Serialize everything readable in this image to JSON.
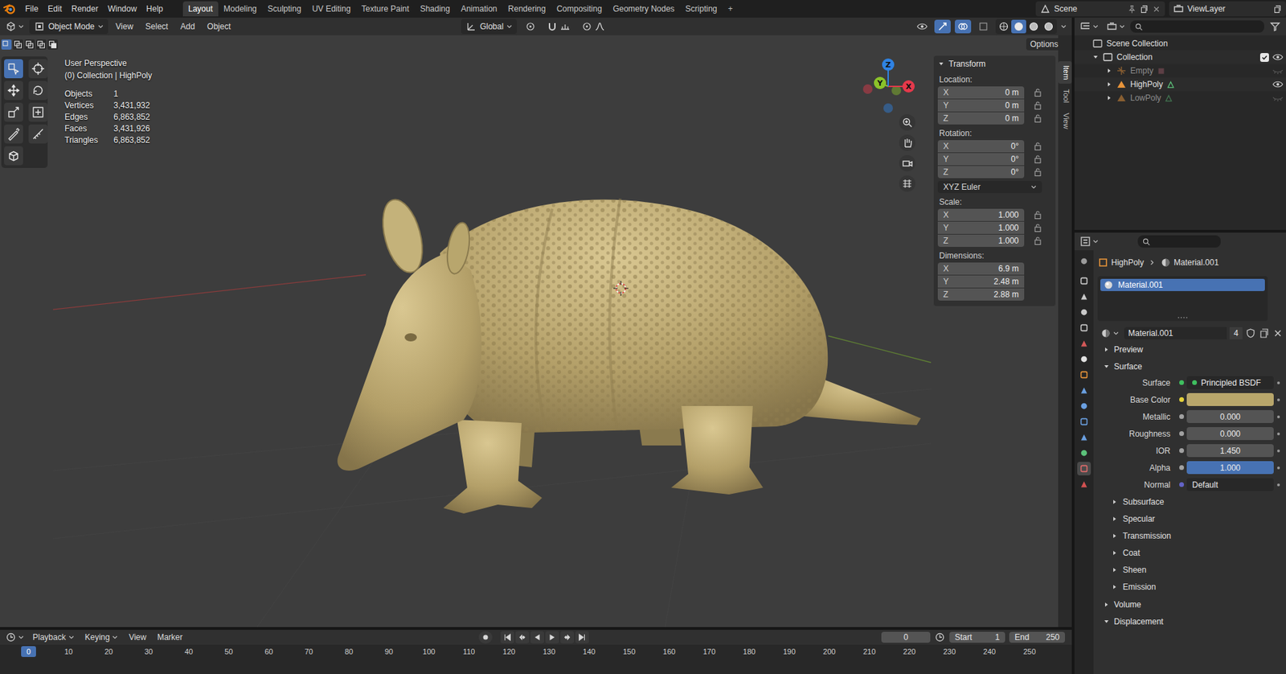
{
  "top_bar": {
    "menus": [
      "File",
      "Edit",
      "Render",
      "Window",
      "Help"
    ],
    "workspaces": [
      {
        "label": "Layout",
        "selected": true
      },
      {
        "label": "Modeling",
        "selected": false
      },
      {
        "label": "Sculpting",
        "selected": false
      },
      {
        "label": "UV Editing",
        "selected": false
      },
      {
        "label": "Texture Paint",
        "selected": false
      },
      {
        "label": "Shading",
        "selected": false
      },
      {
        "label": "Animation",
        "selected": false
      },
      {
        "label": "Rendering",
        "selected": false
      },
      {
        "label": "Compositing",
        "selected": false
      },
      {
        "label": "Geometry Nodes",
        "selected": false
      },
      {
        "label": "Scripting",
        "selected": false
      }
    ],
    "add_workspace": "+",
    "scene": "Scene",
    "view_layer": "ViewLayer"
  },
  "viewport": {
    "header": {
      "mode": "Object Mode",
      "menus": [
        "View",
        "Select",
        "Add",
        "Object"
      ],
      "orientation": "Global",
      "options": "Options",
      "select_modes": [
        {
          "selected": true
        },
        {
          "selected": false
        },
        {
          "selected": false
        },
        {
          "selected": false
        },
        {
          "selected": false
        }
      ],
      "shading": [
        {
          "selected": false
        },
        {
          "selected": true
        },
        {
          "selected": false
        },
        {
          "selected": false
        }
      ]
    },
    "tools": [
      {
        "selected": true
      },
      {
        "selected": false
      },
      {
        "selected": false
      },
      {
        "selected": false
      },
      {
        "selected": false
      },
      {
        "selected": false
      },
      {
        "selected": false
      },
      {
        "selected": false
      },
      {
        "selected": false
      }
    ],
    "overlay": {
      "view": "User Perspective",
      "context": "(0) Collection | HighPoly",
      "stats": [
        {
          "label": "Objects",
          "value": "1"
        },
        {
          "label": "Vertices",
          "value": "3,431,932"
        },
        {
          "label": "Edges",
          "value": "6,863,852"
        },
        {
          "label": "Faces",
          "value": "3,431,926"
        },
        {
          "label": "Triangles",
          "value": "6,863,852"
        }
      ]
    },
    "gizmo": {
      "axes": [
        {
          "label": "X",
          "color": "#e5394b"
        },
        {
          "label": "Y",
          "color": "#8bc32a"
        },
        {
          "label": "Z",
          "color": "#2f83e3"
        }
      ]
    },
    "sidebar": {
      "tabs": [
        {
          "label": "Item",
          "selected": true
        },
        {
          "label": "Tool",
          "selected": false
        },
        {
          "label": "View",
          "selected": false
        }
      ],
      "panel": "Transform",
      "groups": [
        {
          "label": "Location:",
          "locks": true,
          "fields": [
            {
              "axis": "X",
              "value": "0 m"
            },
            {
              "axis": "Y",
              "value": "0 m"
            },
            {
              "axis": "Z",
              "value": "0 m"
            }
          ]
        },
        {
          "label": "Rotation:",
          "locks": true,
          "mode": "XYZ Euler",
          "fields": [
            {
              "axis": "X",
              "value": "0°"
            },
            {
              "axis": "Y",
              "value": "0°"
            },
            {
              "axis": "Z",
              "value": "0°"
            }
          ]
        },
        {
          "label": "Scale:",
          "locks": true,
          "fields": [
            {
              "axis": "X",
              "value": "1.000"
            },
            {
              "axis": "Y",
              "value": "1.000"
            },
            {
              "axis": "Z",
              "value": "1.000"
            }
          ]
        },
        {
          "label": "Dimensions:",
          "locks": false,
          "fields": [
            {
              "axis": "X",
              "value": "6.9 m"
            },
            {
              "axis": "Y",
              "value": "2.48 m"
            },
            {
              "axis": "Z",
              "value": "2.88 m"
            }
          ]
        }
      ]
    }
  },
  "outliner": {
    "root": "Scene Collection",
    "collection": {
      "name": "Collection",
      "checked": true,
      "expanded": true,
      "children": [
        {
          "name": "Empty",
          "kind": "empty",
          "disabled": true,
          "visible": false,
          "expanded": false
        },
        {
          "name": "HighPoly",
          "kind": "mesh",
          "disabled": false,
          "visible": true,
          "expanded": false
        },
        {
          "name": "LowPoly",
          "kind": "mesh",
          "disabled": true,
          "visible": false,
          "expanded": false
        }
      ]
    }
  },
  "properties": {
    "tabs": [
      {
        "color": "#9b9b9b",
        "selected": false
      },
      {
        "color": "#c9c9c9",
        "selected": false
      },
      {
        "color": "#c9c9c9",
        "selected": false
      },
      {
        "color": "#c9c9c9",
        "selected": false
      },
      {
        "color": "#c9c9c9",
        "selected": false
      },
      {
        "color": "#d35858",
        "selected": false
      },
      {
        "color": "#e0e0e0",
        "selected": false
      },
      {
        "color": "#e8943a",
        "selected": false
      },
      {
        "color": "#6a9fe0",
        "selected": false
      },
      {
        "color": "#6a9fe0",
        "selected": false
      },
      {
        "color": "#6a9fe0",
        "selected": false
      },
      {
        "color": "#6a9fe0",
        "selected": false
      },
      {
        "color": "#5cc27a",
        "selected": false
      },
      {
        "color": "#e06b6b",
        "selected": true
      },
      {
        "color": "#d25151",
        "selected": false
      }
    ],
    "breadcrumb": [
      "HighPoly",
      "Material.001"
    ],
    "slots": [
      {
        "name": "Material.001",
        "selected": true
      }
    ],
    "material": {
      "name": "Material.001",
      "users": "4"
    },
    "sections": [
      {
        "label": "Preview",
        "expanded": false,
        "fields": [],
        "subpanels": []
      },
      {
        "label": "Surface",
        "expanded": true,
        "fields": [
          {
            "label": "Surface",
            "kind": "shader",
            "value": "Principled BSDF",
            "socket": "#3fbf5f"
          },
          {
            "label": "Base Color",
            "kind": "color",
            "color": "#b8a66b",
            "socket": "#e5d23a"
          },
          {
            "label": "Metallic",
            "kind": "slider",
            "value": "0.000",
            "level": 0,
            "socket": "#a1a1a1"
          },
          {
            "label": "Roughness",
            "kind": "slider",
            "value": "0.000",
            "level": 0,
            "socket": "#a1a1a1"
          },
          {
            "label": "IOR",
            "kind": "slider",
            "value": "1.450",
            "level": 0,
            "socket": "#a1a1a1"
          },
          {
            "label": "Alpha",
            "kind": "slider",
            "value": "1.000",
            "level": 1,
            "socket": "#a1a1a1"
          },
          {
            "label": "Normal",
            "kind": "link",
            "value": "Default",
            "socket": "#6363c7"
          }
        ],
        "subpanels": [
          {
            "label": "Subsurface",
            "expanded": false
          },
          {
            "label": "Specular",
            "expanded": false
          },
          {
            "label": "Transmission",
            "expanded": false
          },
          {
            "label": "Coat",
            "expanded": false
          },
          {
            "label": "Sheen",
            "expanded": false
          },
          {
            "label": "Emission",
            "expanded": false
          }
        ]
      },
      {
        "label": "Volume",
        "expanded": false,
        "fields": [],
        "subpanels": []
      },
      {
        "label": "Displacement",
        "expanded": true,
        "fields": [],
        "subpanels": []
      }
    ]
  },
  "timeline": {
    "menus": [
      {
        "label": "Playback",
        "dropdown": true
      },
      {
        "label": "Keying",
        "dropdown": true
      },
      {
        "label": "View",
        "dropdown": false
      },
      {
        "label": "Marker",
        "dropdown": false
      }
    ],
    "current_frame": "0",
    "start": {
      "label": "Start",
      "value": "1"
    },
    "end": {
      "label": "End",
      "value": "250"
    },
    "ruler": [
      "0",
      "10",
      "20",
      "30",
      "40",
      "50",
      "60",
      "70",
      "80",
      "90",
      "100",
      "110",
      "120",
      "130",
      "140",
      "150",
      "160",
      "170",
      "180",
      "190",
      "200",
      "210",
      "220",
      "230",
      "240",
      "250"
    ],
    "playhead": "0"
  }
}
